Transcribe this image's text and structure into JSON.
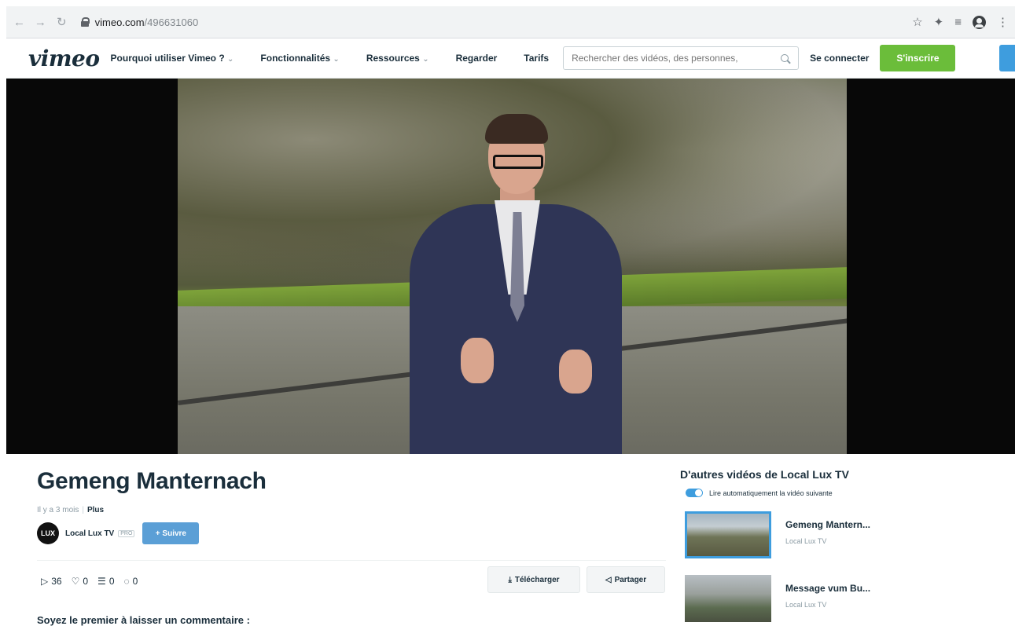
{
  "browser": {
    "url_host": "vimeo.com",
    "url_path": "/496631060",
    "nav_icons": [
      "back-arrow-icon",
      "forward-arrow-icon",
      "reload-icon"
    ],
    "toolbar_icons": [
      "star-icon",
      "extensions-puzzle-icon",
      "reading-list-icon",
      "profile-icon",
      "menu-dots-icon"
    ]
  },
  "nav": {
    "logo": "vimeo",
    "items": [
      {
        "label": "Pourquoi utiliser Vimeo ?",
        "has_caret": true
      },
      {
        "label": "Fonctionnalités",
        "has_caret": true
      },
      {
        "label": "Ressources",
        "has_caret": true
      },
      {
        "label": "Regarder",
        "has_caret": false
      },
      {
        "label": "Tarifs",
        "has_caret": false
      }
    ],
    "caret": "⌄",
    "search_placeholder": "Rechercher des vidéos, des personnes,",
    "login": "Se connecter",
    "signup": "S'inscrire",
    "colors": {
      "signup": "#6bbd3a",
      "accent_blue": "#3e9dde"
    }
  },
  "video": {
    "title": "Gemeng Manternach",
    "posted": "Il y a 3 mois",
    "more": "Plus",
    "owner": "Local Lux TV",
    "owner_avatar_text": "LUX",
    "badge": "PRO",
    "follow": "+ Suivre",
    "stats": {
      "plays": "36",
      "likes": "0",
      "collections": "0",
      "comments": "0"
    },
    "download": "Télécharger",
    "share": "Partager",
    "comment_prompt": "Soyez le premier à laisser un commentaire :"
  },
  "sidebar": {
    "heading": "D'autres vidéos de Local Lux TV",
    "autoplay_label": "Lire automatiquement la vidéo suivante",
    "items": [
      {
        "title": "Gemeng Mantern...",
        "owner": "Local Lux TV",
        "active": true
      },
      {
        "title": "Message vum Bu...",
        "owner": "Local Lux TV",
        "active": false
      }
    ]
  }
}
